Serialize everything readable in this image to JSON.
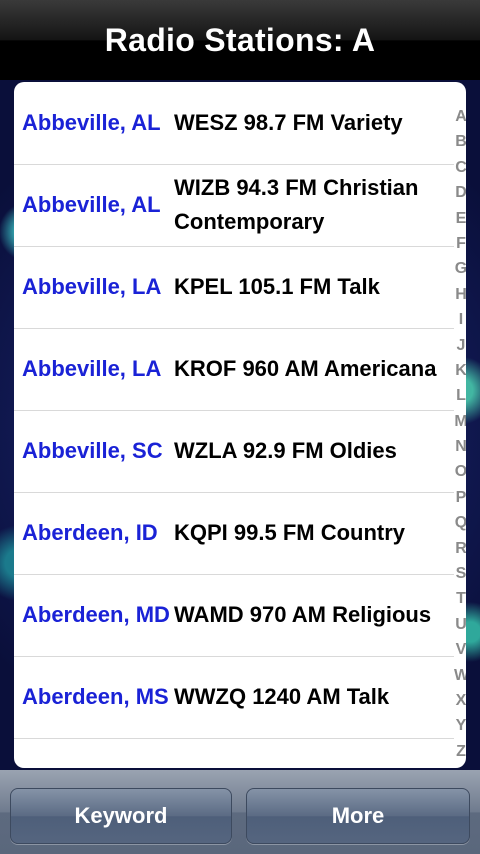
{
  "header": {
    "title": "Radio Stations: A"
  },
  "stations": [
    {
      "city": "Abbeville, AL",
      "station": "WESZ 98.7 FM Variety"
    },
    {
      "city": "Abbeville, AL",
      "station": "WIZB 94.3 FM Christian Contemporary"
    },
    {
      "city": "Abbeville, LA",
      "station": "KPEL 105.1 FM Talk"
    },
    {
      "city": "Abbeville, LA",
      "station": "KROF 960 AM Americana"
    },
    {
      "city": "Abbeville, SC",
      "station": "WZLA 92.9 FM Oldies"
    },
    {
      "city": "Aberdeen, ID",
      "station": "KQPI 99.5 FM Country"
    },
    {
      "city": "Aberdeen, MD",
      "station": "WAMD 970 AM Religious"
    },
    {
      "city": "Aberdeen, MS",
      "station": "WWZQ 1240 AM Talk"
    }
  ],
  "index_letters": [
    "A",
    "B",
    "C",
    "D",
    "E",
    "F",
    "G",
    "H",
    "I",
    "J",
    "K",
    "L",
    "M",
    "N",
    "O",
    "P",
    "Q",
    "R",
    "S",
    "T",
    "U",
    "V",
    "W",
    "X",
    "Y",
    "Z"
  ],
  "toolbar": {
    "keyword_label": "Keyword",
    "more_label": "More"
  },
  "colors": {
    "city_text": "#1a22d6",
    "title_text": "#ffffff"
  }
}
